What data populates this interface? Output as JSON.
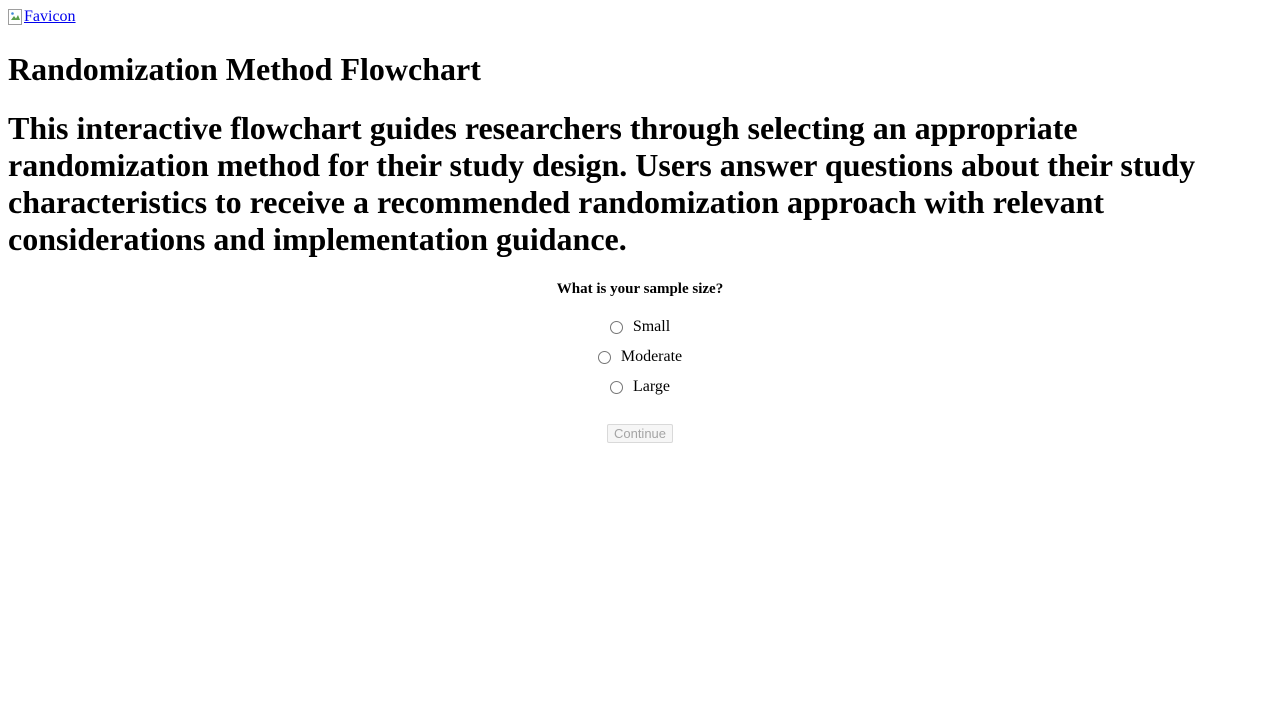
{
  "header": {
    "favicon_alt": "Favicon"
  },
  "page": {
    "title": "Randomization Method Flowchart",
    "description": "This interactive flowchart guides researchers through selecting an appropriate randomization method for their study design. Users answer questions about their study characteristics to receive a recommended randomization approach with relevant considerations and implementation guidance."
  },
  "question": {
    "text": "What is your sample size?",
    "options": [
      {
        "label": "Small",
        "selected": false
      },
      {
        "label": "Moderate",
        "selected": false
      },
      {
        "label": "Large",
        "selected": false
      }
    ],
    "continue_label": "Continue",
    "continue_enabled": false
  },
  "colors": {
    "link": "#0000ee",
    "disabled_text": "#a5a5a5"
  },
  "icons": {
    "favicon": "broken-image-icon"
  }
}
